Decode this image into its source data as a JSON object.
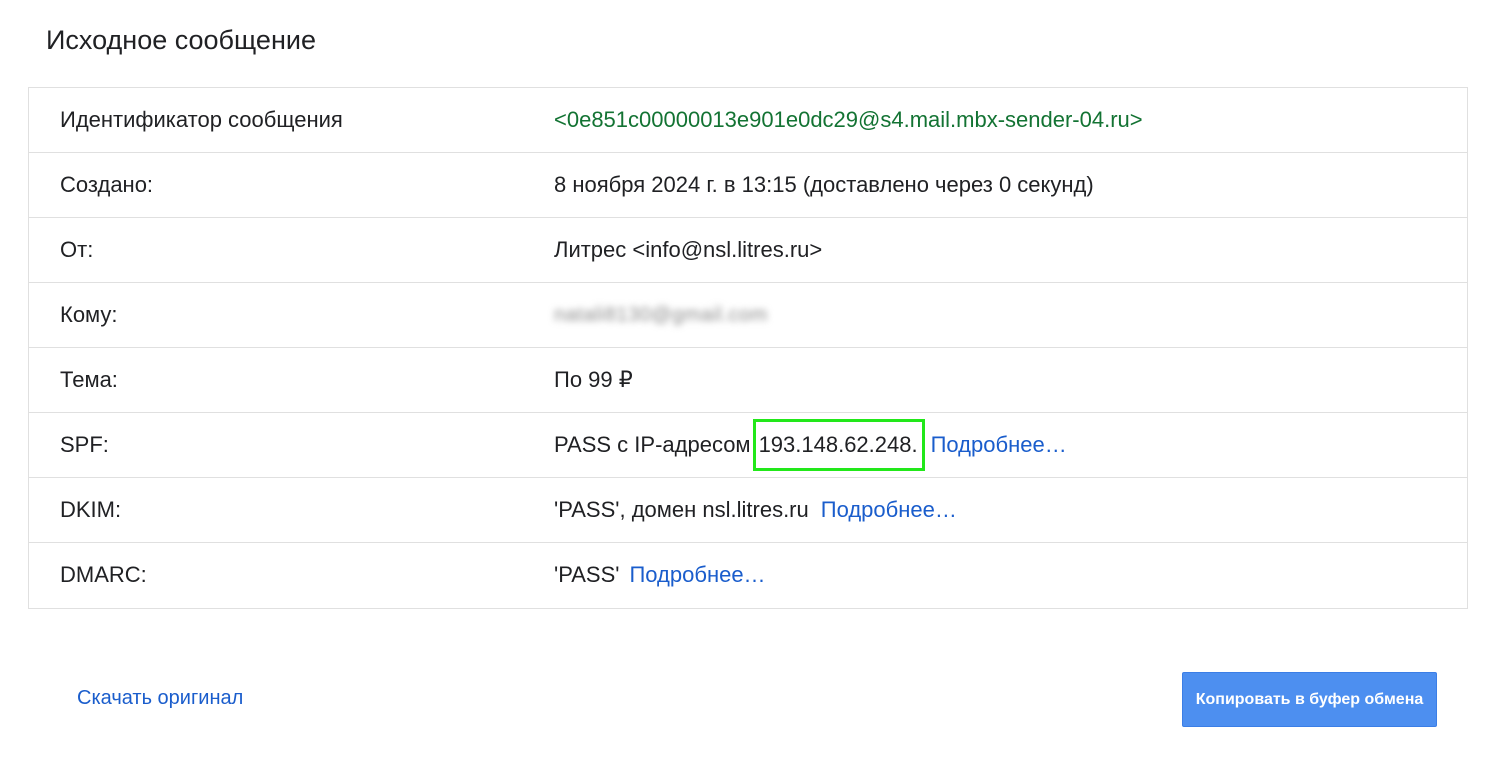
{
  "header": {
    "title": "Исходное сообщение"
  },
  "rows": {
    "message_id": {
      "label": "Идентификатор сообщения",
      "value": "<0e851c00000013e901e0dc29@s4.mail.mbx-sender-04.ru>"
    },
    "created": {
      "label": "Создано:",
      "value": "8 ноября 2024 г. в 13:15 (доставлено через 0 секунд)"
    },
    "from": {
      "label": "От:",
      "value": "Литрес <info@nsl.litres.ru>"
    },
    "to": {
      "label": "Кому:",
      "value": "natali8130@gmail.com"
    },
    "subject": {
      "label": "Тема:",
      "value": "По 99 ₽"
    },
    "spf": {
      "label": "SPF:",
      "value_prefix": "PASS с IP-адресом",
      "ip": "193.148.62.248.",
      "link": "Подробнее…"
    },
    "dkim": {
      "label": "DKIM:",
      "value": "'PASS', домен nsl.litres.ru",
      "link": "Подробнее…"
    },
    "dmarc": {
      "label": "DMARC:",
      "value": "'PASS'",
      "link": "Подробнее…"
    }
  },
  "footer": {
    "download_link": "Скачать оригинал",
    "copy_button": "Копировать в буфер обмена"
  },
  "colors": {
    "link": "#1a5dcc",
    "message_id": "#137333",
    "highlight_box": "#22e81a",
    "button_bg": "#4d8ff0"
  }
}
